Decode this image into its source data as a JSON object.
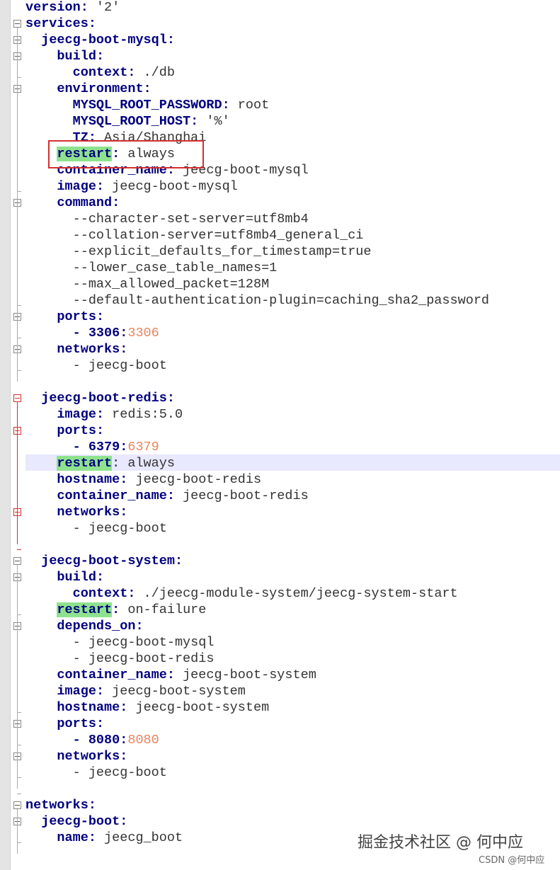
{
  "lines": [
    {
      "k": "version",
      "v": " '2'",
      "ind": 0
    },
    {
      "k": "services",
      "v": "",
      "ind": 0
    },
    {
      "k": "jeecg-boot-mysql",
      "v": "",
      "ind": 1
    },
    {
      "k": "build",
      "v": "",
      "ind": 2
    },
    {
      "k": "context",
      "v": " ./db",
      "ind": 3
    },
    {
      "k": "environment",
      "v": "",
      "ind": 2
    },
    {
      "k": "MYSQL_ROOT_PASSWORD",
      "v": " root",
      "ind": 3
    },
    {
      "k": "MYSQL_ROOT_HOST",
      "v": " '%'",
      "ind": 3
    },
    {
      "k": "TZ",
      "v": " Asia/Shanghai",
      "ind": 3
    },
    {
      "k": "restart",
      "v": " always",
      "ind": 2,
      "hl": true
    },
    {
      "k": "container_name",
      "v": " jeecg-boot-mysql",
      "ind": 2
    },
    {
      "k": "image",
      "v": " jeecg-boot-mysql",
      "ind": 2
    },
    {
      "k": "command",
      "v": "",
      "ind": 2
    },
    {
      "plain": "--character-set-server=utf8mb4",
      "ind": 3
    },
    {
      "plain": "--collation-server=utf8mb4_general_ci",
      "ind": 3
    },
    {
      "plain": "--explicit_defaults_for_timestamp=true",
      "ind": 3
    },
    {
      "plain": "--lower_case_table_names=1",
      "ind": 3
    },
    {
      "plain": "--max_allowed_packet=128M",
      "ind": 3
    },
    {
      "plain": "--default-authentication-plugin=caching_sha2_password",
      "ind": 3
    },
    {
      "k": "ports",
      "v": "",
      "ind": 2
    },
    {
      "port": "3306",
      "port2": "3306",
      "ind": 3
    },
    {
      "k": "networks",
      "v": "",
      "ind": 2
    },
    {
      "plain": "- jeecg-boot",
      "ind": 3
    },
    {
      "blank": true
    },
    {
      "k": "jeecg-boot-redis",
      "v": "",
      "ind": 1
    },
    {
      "k": "image",
      "v": " redis:5.0",
      "ind": 2
    },
    {
      "k": "ports",
      "v": "",
      "ind": 2
    },
    {
      "port": "6379",
      "port2": "6379",
      "ind": 3
    },
    {
      "k": "restart",
      "v": ": always",
      "ind": 2,
      "hl": true,
      "partial": true
    },
    {
      "k": "hostname",
      "v": " jeecg-boot-redis",
      "ind": 2
    },
    {
      "k": "container_name",
      "v": " jeecg-boot-redis",
      "ind": 2
    },
    {
      "k": "networks",
      "v": "",
      "ind": 2
    },
    {
      "plain": "- jeecg-boot",
      "ind": 3
    },
    {
      "blank": true
    },
    {
      "k": "jeecg-boot-system",
      "v": "",
      "ind": 1
    },
    {
      "k": "build",
      "v": "",
      "ind": 2
    },
    {
      "k": "context",
      "v": " ./jeecg-module-system/jeecg-system-start",
      "ind": 3
    },
    {
      "k": "restart",
      "v": " on-failure",
      "ind": 2,
      "hl": true
    },
    {
      "k": "depends_on",
      "v": "",
      "ind": 2
    },
    {
      "plain": "- jeecg-boot-mysql",
      "ind": 3
    },
    {
      "plain": "- jeecg-boot-redis",
      "ind": 3
    },
    {
      "k": "container_name",
      "v": " jeecg-boot-system",
      "ind": 2
    },
    {
      "k": "image",
      "v": " jeecg-boot-system",
      "ind": 2
    },
    {
      "k": "hostname",
      "v": " jeecg-boot-system",
      "ind": 2
    },
    {
      "k": "ports",
      "v": "",
      "ind": 2
    },
    {
      "port": "8080",
      "port2": "8080",
      "ind": 3
    },
    {
      "k": "networks",
      "v": "",
      "ind": 2
    },
    {
      "plain": "- jeecg-boot",
      "ind": 3
    },
    {
      "blank": true
    },
    {
      "k": "networks",
      "v": "",
      "ind": 0
    },
    {
      "k": "jeecg-boot",
      "v": "",
      "ind": 1
    },
    {
      "k": "name",
      "v": " jeecg_boot",
      "ind": 2
    }
  ],
  "watermark": "掘金技术社区 @ 何中应",
  "csdn": "CSDN @何中应",
  "colors": {
    "key": "#000080",
    "highlight": "#8ee28e",
    "portAlt": "#e8845c",
    "box": "#d43030",
    "currentLine": "#e8e8ff"
  }
}
